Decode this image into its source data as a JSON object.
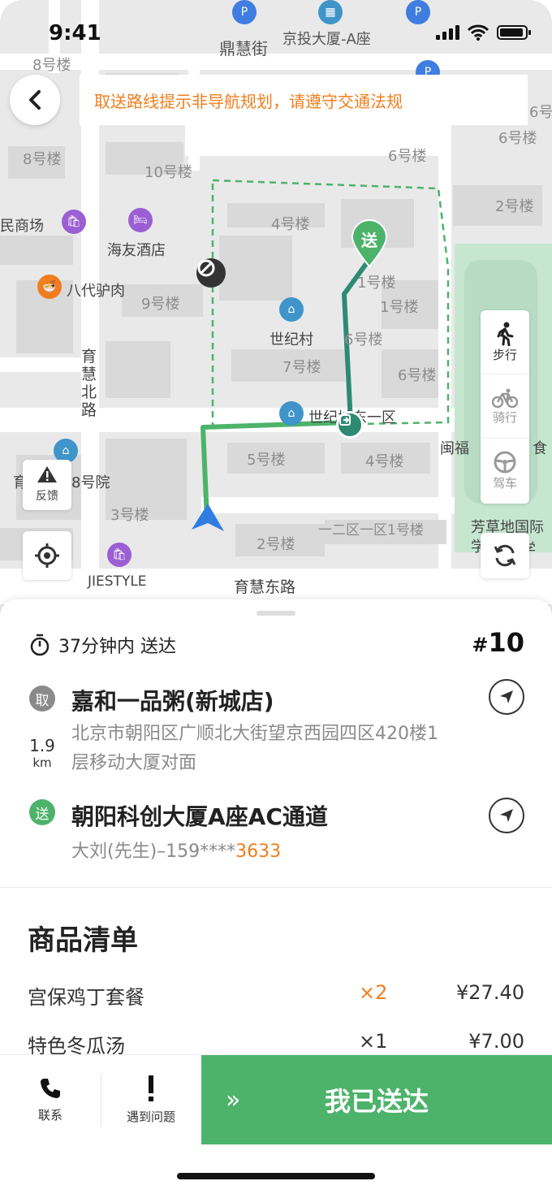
{
  "status_bar": {
    "time": "9:41"
  },
  "map": {
    "streets": [
      "鼎慧街",
      "育慧北路",
      "育慧东路"
    ],
    "buildings": [
      "8号楼",
      "8号楼",
      "10号楼",
      "6号楼",
      "6号楼",
      "6号楼",
      "4号楼",
      "2号楼",
      "1号楼",
      "1号楼",
      "9号楼",
      "6号楼",
      "7号楼",
      "6号楼",
      "5号楼",
      "4号楼",
      "3号楼",
      "2号楼",
      "一二区一区1号楼",
      "育慧北路8号院"
    ],
    "pois": [
      "京投大厦-A座",
      "民商场",
      "海友酒店",
      "八代驴肉",
      "世纪村",
      "世纪城东一区",
      "闽福",
      "食",
      "芳草地国际学校",
      "小学",
      "JIESTYLE"
    ],
    "destination_marker": "送"
  },
  "notice": "取送路线提示非导航规划，请遵守交通法规",
  "side_buttons": {
    "feedback": "反馈"
  },
  "travel_modes": [
    {
      "label": "步行",
      "icon": "walk-icon",
      "active": true
    },
    {
      "label": "骑行",
      "icon": "bike-icon",
      "active": false
    },
    {
      "label": "驾车",
      "icon": "car-icon",
      "active": false
    }
  ],
  "order": {
    "eta": "37分钟内 送达",
    "number_prefix": "#",
    "number": "10",
    "pickup": {
      "badge": "取",
      "name": "嘉和一品粥(新城店)",
      "address": "北京市朝阳区广顺北大街望京西园四区420楼1层移动大厦对面",
      "distance": "1.9",
      "distance_unit": "km"
    },
    "delivery": {
      "badge": "送",
      "name": "朝阳科创大厦A座AC通道",
      "contact": "大刘(先生)–159****",
      "phone_tail": "3633"
    }
  },
  "goods": {
    "title": "商品清单",
    "items": [
      {
        "name": "宫保鸡丁套餐",
        "qty": "×2",
        "price": "¥27.40"
      },
      {
        "name": "特色冬瓜汤",
        "qty": "×1",
        "price": "¥7.00"
      }
    ]
  },
  "bottom_bar": {
    "contact": "联系",
    "problem": "遇到问题",
    "confirm": "我已送达",
    "confirm_chevron": "»"
  },
  "colors": {
    "accent_green": "#4db36a",
    "route_teal": "#2e8b72",
    "warning_orange": "#f07e1e",
    "nav_blue": "#2f7de1"
  }
}
